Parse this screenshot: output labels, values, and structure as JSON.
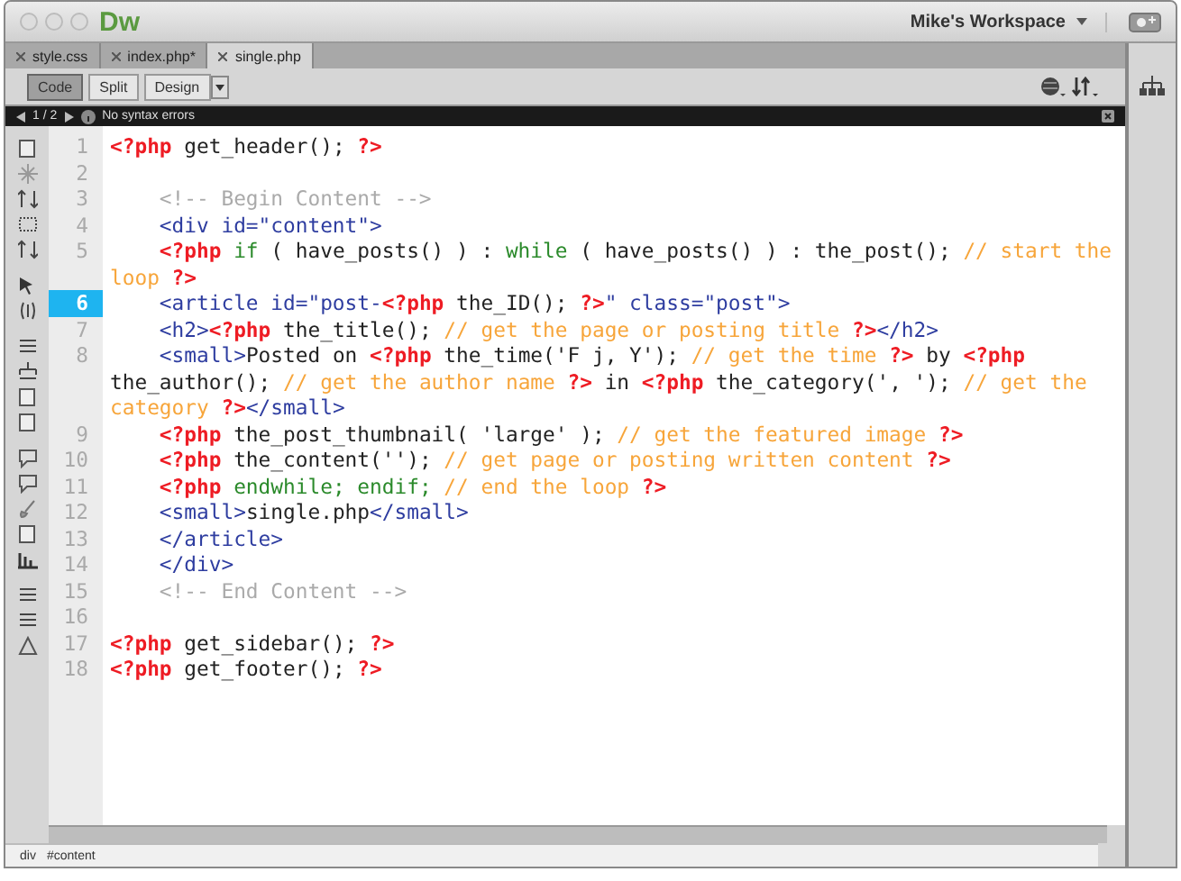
{
  "app": {
    "logo": "Dw",
    "workspace": "Mike's Workspace"
  },
  "tabs": [
    {
      "label": "style.css",
      "selected": false
    },
    {
      "label": "index.php*",
      "selected": false
    },
    {
      "label": "single.php",
      "selected": true
    }
  ],
  "view_buttons": [
    {
      "label": "Code",
      "selected": true
    },
    {
      "label": "Split",
      "selected": false
    },
    {
      "label": "Design",
      "selected": false
    }
  ],
  "info_bar": {
    "page": "1 / 2",
    "message": "No syntax errors"
  },
  "code_lines": [
    {
      "number": "1",
      "selected": false,
      "indented": false,
      "tokens": [
        {
          "kind": "php",
          "text": "<?php"
        },
        {
          "kind": "plain",
          "text": " get_header(); "
        },
        {
          "kind": "php",
          "text": "?>"
        }
      ]
    },
    {
      "number": "2",
      "selected": false
    },
    {
      "number": "3",
      "selected": false,
      "indented": true,
      "tokens": [
        {
          "kind": "hcomment",
          "text": "<!-- Begin Content -->"
        }
      ]
    },
    {
      "number": "4",
      "selected": false,
      "indented": true,
      "tokens": [
        {
          "kind": "tag",
          "text": "<div id=\"content\">"
        }
      ]
    },
    {
      "number": "5",
      "selected": false,
      "indented": true,
      "tokens": [
        {
          "kind": "php",
          "text": "<?php "
        },
        {
          "kind": "kw",
          "text": "if"
        },
        {
          "kind": "plain",
          "text": " ( have_posts() ) : "
        },
        {
          "kind": "kw",
          "text": "while"
        },
        {
          "kind": "plain",
          "text": " ( have_posts() ) : the_post(); "
        },
        {
          "kind": "comment",
          "text": "// start the loop "
        },
        {
          "kind": "php",
          "text": "?>"
        }
      ]
    },
    {
      "number": "6",
      "selected": true,
      "indented": true,
      "tokens": [
        {
          "kind": "tag",
          "text": "<article id=\"post-"
        },
        {
          "kind": "php",
          "text": "<?php"
        },
        {
          "kind": "plain",
          "text": " the_ID(); "
        },
        {
          "kind": "php",
          "text": "?>"
        },
        {
          "kind": "tag",
          "text": "\" class=\"post\">"
        }
      ]
    },
    {
      "number": "7",
      "selected": false,
      "indented": true,
      "tokens": [
        {
          "kind": "tag",
          "text": "<h2>"
        },
        {
          "kind": "php",
          "text": "<?php"
        },
        {
          "kind": "plain",
          "text": " the_title(); "
        },
        {
          "kind": "comment",
          "text": "// get the page or posting title "
        },
        {
          "kind": "php",
          "text": "?>"
        },
        {
          "kind": "tag",
          "text": "</h2>"
        }
      ]
    },
    {
      "number": "8",
      "selected": false,
      "indented": true,
      "tokens": [
        {
          "kind": "tag",
          "text": "<small>"
        },
        {
          "kind": "plain",
          "text": "Posted on "
        },
        {
          "kind": "php",
          "text": "<?php"
        },
        {
          "kind": "plain",
          "text": " the_time('F j, Y'); "
        },
        {
          "kind": "comment",
          "text": "// get the time "
        },
        {
          "kind": "php",
          "text": "?>"
        },
        {
          "kind": "plain",
          "text": " by "
        },
        {
          "kind": "php",
          "text": "<?php"
        },
        {
          "kind": "plain",
          "text": " the_author(); "
        },
        {
          "kind": "comment",
          "text": "// get the author name "
        },
        {
          "kind": "php",
          "text": "?>"
        },
        {
          "kind": "plain",
          "text": " in "
        },
        {
          "kind": "php",
          "text": "<?php"
        },
        {
          "kind": "plain",
          "text": " the_category(', '); "
        },
        {
          "kind": "comment",
          "text": "// get the category "
        },
        {
          "kind": "php",
          "text": "?>"
        },
        {
          "kind": "tag",
          "text": "</small>"
        }
      ]
    },
    {
      "number": "9",
      "selected": false,
      "indented": true,
      "tokens": [
        {
          "kind": "php",
          "text": "<?php"
        },
        {
          "kind": "plain",
          "text": " the_post_thumbnail( 'large' ); "
        },
        {
          "kind": "comment",
          "text": "// get the featured image "
        },
        {
          "kind": "php",
          "text": "?>"
        }
      ]
    },
    {
      "number": "10",
      "selected": false,
      "indented": true,
      "tokens": [
        {
          "kind": "php",
          "text": "<?php"
        },
        {
          "kind": "plain",
          "text": " the_content(''); "
        },
        {
          "kind": "comment",
          "text": "// get page or posting written content "
        },
        {
          "kind": "php",
          "text": "?>"
        }
      ]
    },
    {
      "number": "11",
      "selected": false,
      "indented": true,
      "tokens": [
        {
          "kind": "php",
          "text": "<?php "
        },
        {
          "kind": "kw",
          "text": "endwhile; endif; "
        },
        {
          "kind": "comment",
          "text": "// end the loop "
        },
        {
          "kind": "php",
          "text": "?>"
        }
      ]
    },
    {
      "number": "12",
      "selected": false,
      "indented": true,
      "tokens": [
        {
          "kind": "tag",
          "text": "<small>"
        },
        {
          "kind": "plain",
          "text": "single.php"
        },
        {
          "kind": "tag",
          "text": "</small>"
        }
      ]
    },
    {
      "number": "13",
      "selected": false,
      "indented": true,
      "tokens": [
        {
          "kind": "tag",
          "text": "</article>"
        }
      ]
    },
    {
      "number": "14",
      "selected": false,
      "indented": true,
      "tokens": [
        {
          "kind": "tag",
          "text": "</div>"
        }
      ]
    },
    {
      "number": "15",
      "selected": false,
      "indented": true,
      "tokens": [
        {
          "kind": "hcomment",
          "text": "<!-- End Content -->"
        }
      ]
    },
    {
      "number": "16",
      "selected": false
    },
    {
      "number": "17",
      "selected": false,
      "indented": false,
      "tokens": [
        {
          "kind": "php",
          "text": "<?php"
        },
        {
          "kind": "plain",
          "text": " get_sidebar(); "
        },
        {
          "kind": "php",
          "text": "?>"
        }
      ]
    },
    {
      "number": "18",
      "selected": false,
      "indented": false,
      "tokens": [
        {
          "kind": "php",
          "text": "<?php"
        },
        {
          "kind": "plain",
          "text": " get_footer(); "
        },
        {
          "kind": "php",
          "text": "?>"
        }
      ]
    }
  ],
  "status_bar": {
    "breadcrumbs": [
      "div",
      "#content"
    ]
  }
}
